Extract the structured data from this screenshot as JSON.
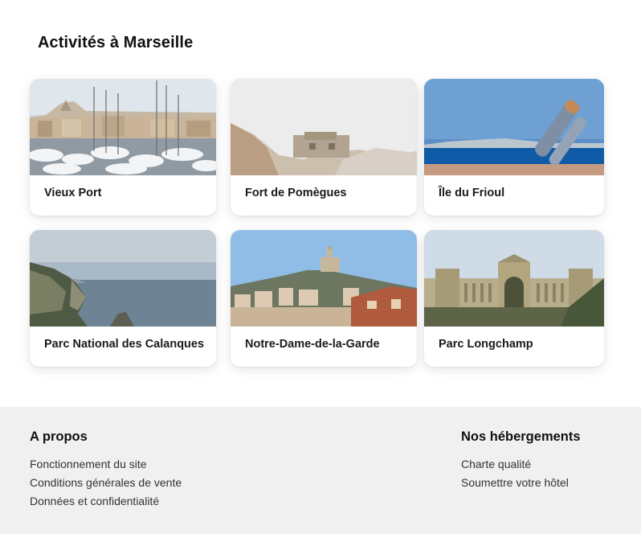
{
  "section": {
    "title": "Activités à Marseille"
  },
  "activities": [
    {
      "label": "Vieux Port",
      "image": "harbor-boats-photo"
    },
    {
      "label": "Fort de Pomègues",
      "image": "rocky-fort-photo"
    },
    {
      "label": "Île du Frioul",
      "image": "sea-island-telescope-photo"
    },
    {
      "label": "Parc National des Calanques",
      "image": "cliffs-sea-photo"
    },
    {
      "label": "Notre-Dame-de-la-Garde",
      "image": "hilltop-basilica-city-photo"
    },
    {
      "label": "Parc Longchamp",
      "image": "palace-colonnade-photo"
    }
  ],
  "footer": {
    "about": {
      "title": "A propos",
      "links": [
        "Fonctionnement du site",
        "Conditions générales de vente",
        "Données et confidentialité"
      ]
    },
    "lodging": {
      "title": "Nos hébergements",
      "links": [
        "Charte qualité",
        "Soumettre votre hôtel"
      ]
    }
  },
  "colors": {
    "footer_bg": "#f0f0f0",
    "card_bg": "#ffffff",
    "text": "#111111"
  }
}
